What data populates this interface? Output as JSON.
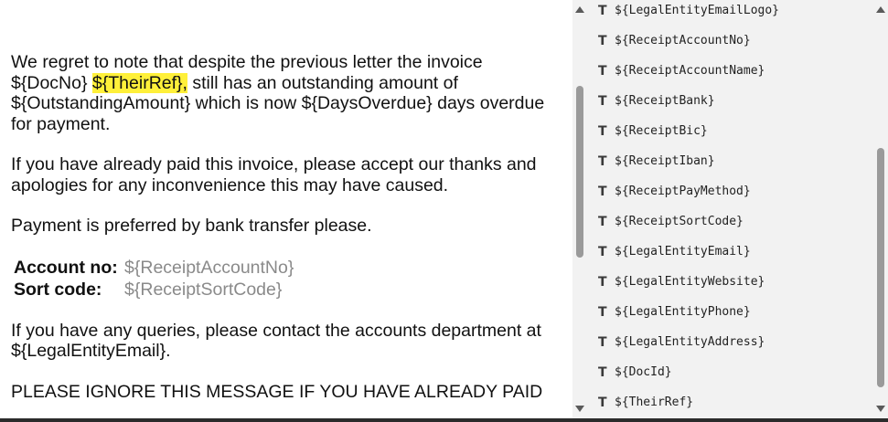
{
  "letter": {
    "p1_before": "We regret to note that despite the previous letter the invoice ${DocNo} ",
    "p1_highlight": "${TheirRef},",
    "p1_after": " still has an outstanding amount of ${OutstandingAmount} which is now ${DaysOverdue} days overdue for payment.",
    "p2": "If you have already paid this invoice, please accept our thanks and apologies for any inconvenience this may have caused.",
    "p3": "Payment is preferred by bank transfer please.",
    "account_label": "Account no:",
    "account_value": "${ReceiptAccountNo}",
    "sort_label": "Sort code:",
    "sort_value": "${ReceiptSortCode}",
    "p4": "If you have any queries, please contact the accounts department at ${LegalEntityEmail}.",
    "p5": "PLEASE IGNORE THIS MESSAGE IF YOU HAVE ALREADY PAID"
  },
  "field_panel": {
    "icon": "T",
    "items": [
      "${LegalEntityEmailLogo}",
      "${ReceiptAccountNo}",
      "${ReceiptAccountName}",
      "${ReceiptBank}",
      "${ReceiptBic}",
      "${ReceiptIban}",
      "${ReceiptPayMethod}",
      "${ReceiptSortCode}",
      "${LegalEntityEmail}",
      "${LegalEntityWebsite}",
      "${LegalEntityPhone}",
      "${LegalEntityAddress}",
      "${DocId}",
      "${TheirRef}"
    ]
  },
  "colors": {
    "highlight": "#fff03a",
    "placeholder_text": "#8a8a8a",
    "panel_background": "#f2f2f2"
  }
}
